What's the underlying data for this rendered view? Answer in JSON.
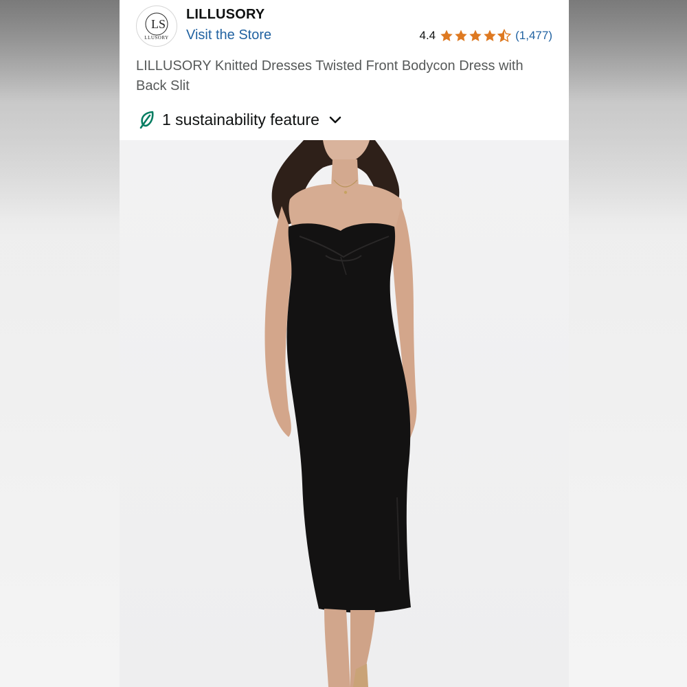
{
  "store": {
    "brand_name": "LILLUSORY",
    "logo_monogram": "LS",
    "logo_wordmark": "LLUSORY",
    "visit_store_label": "Visit the Store"
  },
  "rating": {
    "value": "4.4",
    "stars_out_of_5": 4.5,
    "count_label": "(1,477)",
    "star_color": "#de7921"
  },
  "product": {
    "title": "LILLUSORY Knitted Dresses Twisted Front Bodycon Dress with Back Slit",
    "image_icon": "product-photo-black-strapless-dress"
  },
  "sustainability": {
    "label": "1 sustainability feature",
    "icon": "leaf-icon",
    "icon_color": "#067d62",
    "expand_icon": "chevron-down-icon"
  },
  "colors": {
    "link": "#2162a1",
    "text_primary": "#0f1111",
    "text_secondary": "#565959"
  }
}
